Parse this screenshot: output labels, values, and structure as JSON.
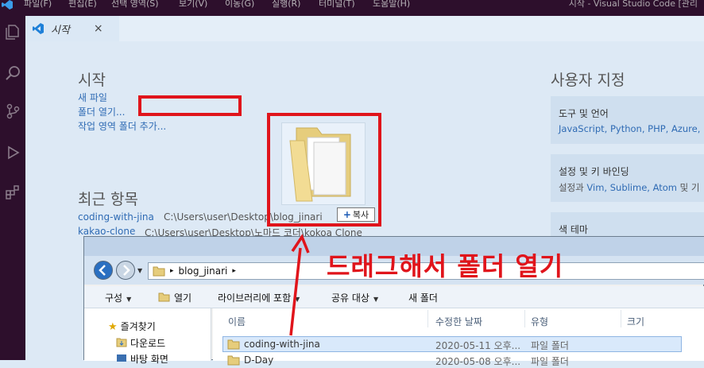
{
  "vscode": {
    "menu": [
      "파일(F)",
      "편집(E)",
      "선택 영역(S)",
      "보기(V)",
      "이동(G)",
      "실행(R)",
      "터미널(T)",
      "도움말(H)"
    ],
    "window_title": "시작 - Visual Studio Code [관리",
    "tab_label": "시작",
    "tab_close": "×"
  },
  "welcome": {
    "start_title": "시작",
    "new_file": "새 파일",
    "open_folder": "폴더 열기...",
    "add_workspace": "작업 영역 폴더 추가...",
    "recent_title": "최근 항목",
    "recent": [
      {
        "name": "coding-with-jina",
        "path": "C:\\Users\\user\\Desktop\\blog_jinari"
      },
      {
        "name": "kakao-clone",
        "path": "C:\\Users\\user\\Desktop\\노마드 코더\\kokoa Clone"
      }
    ],
    "customize_title": "사용자 지정",
    "cards": [
      {
        "title": "도구 및 언어",
        "desc_links": "JavaScript, Python, PHP, Azure, D",
        "desc_prefix": ""
      },
      {
        "title": "설정 및 키 바인딩",
        "desc_prefix": "설정과 ",
        "desc_links": "Vim, Sublime, Atom",
        "desc_suffix": " 및 기"
      },
      {
        "title": "색 테마"
      }
    ]
  },
  "drag": {
    "copy_label": "복사",
    "instruction": "드래그해서 폴더 열기"
  },
  "explorer": {
    "address": "blog_jinari",
    "toolbar": [
      "구성",
      "열기",
      "라이브러리에 포함",
      "공유 대상",
      "새 폴더"
    ],
    "nav": [
      "즐겨찾기",
      "다운로드",
      "바탕 화면"
    ],
    "columns": [
      "이름",
      "수정한 날짜",
      "유형",
      "크기"
    ],
    "rows": [
      {
        "name": "coding-with-jina",
        "date": "2020-05-11 오후...",
        "type": "파일 폴더"
      },
      {
        "name": "D-Day",
        "date": "2020-05-08 오후...",
        "type": "파일 폴더"
      }
    ]
  },
  "colors": {
    "accent_red": "#e0141b",
    "link": "#2f6bb4",
    "vscode_dark": "#2d0f2c"
  }
}
